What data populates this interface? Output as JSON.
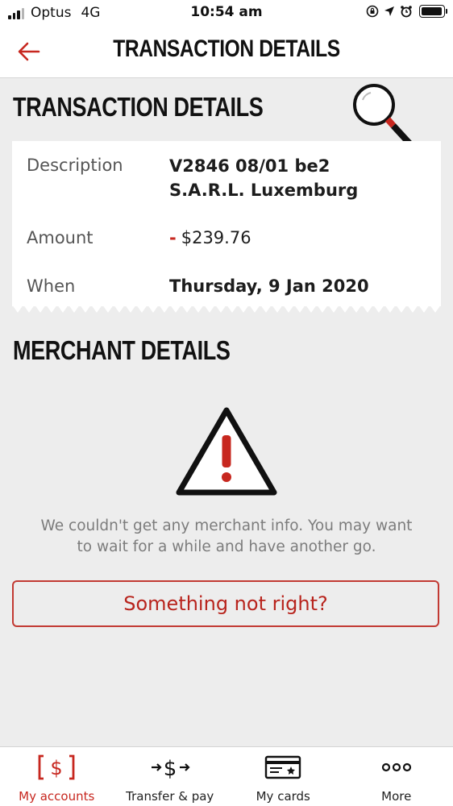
{
  "status_bar": {
    "carrier": "Optus",
    "network": "4G",
    "time": "10:54 am"
  },
  "header": {
    "title": "TRANSACTION DETAILS",
    "back_icon": "arrow-left-icon"
  },
  "transaction": {
    "section_title": "TRANSACTION DETAILS",
    "rows": [
      {
        "label": "Description",
        "value_line1": "V2846 08/01 be2",
        "value_line2": "S.A.R.L. Luxemburg"
      },
      {
        "label": "Amount",
        "sign": "-",
        "value": "$239.76"
      },
      {
        "label": "When",
        "value": "Thursday, 9 Jan 2020"
      }
    ]
  },
  "merchant": {
    "section_title": "MERCHANT DETAILS",
    "message": "We couldn't get any merchant info. You may want to wait for a while and have another go.",
    "button_label": "Something not right?"
  },
  "bottom_nav": {
    "items": [
      {
        "label": "My accounts",
        "icon": "accounts-dollar-icon",
        "active": true
      },
      {
        "label": "Transfer & pay",
        "icon": "transfer-pay-icon",
        "active": false
      },
      {
        "label": "My cards",
        "icon": "card-icon",
        "active": false
      },
      {
        "label": "More",
        "icon": "more-dots-icon",
        "active": false
      }
    ]
  },
  "colors": {
    "accent": "#c7271f",
    "background": "#ededed",
    "card": "#ffffff"
  }
}
